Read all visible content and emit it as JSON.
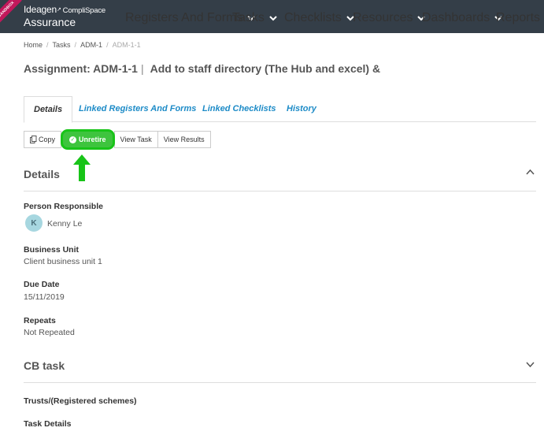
{
  "app": {
    "sandbox_ribbon": "SANDBOX",
    "brand": "Ideagen",
    "brand_sub": "CompliSpace",
    "brand_line2": "Assurance"
  },
  "nav": [
    {
      "label": "Registers And Forms"
    },
    {
      "label": "Tasks"
    },
    {
      "label": "Checklists"
    },
    {
      "label": "Resources"
    },
    {
      "label": "Dashboards"
    },
    {
      "label": "Reports"
    }
  ],
  "breadcrumb": [
    "Home",
    "Tasks",
    "ADM-1",
    "ADM-1-1"
  ],
  "page": {
    "title_prefix": "Assignment:",
    "title_id": "ADM-1-1",
    "title_bar": "|",
    "title_name": "Add to staff directory (The Hub and excel) &"
  },
  "tabs": [
    {
      "label": "Details",
      "active": true
    },
    {
      "label": "Linked Registers And Forms",
      "active": false
    },
    {
      "label": "Linked Checklists",
      "active": false
    },
    {
      "label": "History",
      "active": false
    }
  ],
  "actions": {
    "copy": "Copy",
    "unretire": "Unretire",
    "view_task": "View Task",
    "view_results": "View Results"
  },
  "details": {
    "title": "Details",
    "person_label": "Person Responsible",
    "person_initial": "K",
    "person_name": "Kenny Le",
    "bu_label": "Business Unit",
    "bu_value": "Client business unit 1",
    "due_label": "Due Date",
    "due_value": "15/11/2019",
    "repeats_label": "Repeats",
    "repeats_value": "Not Repeated"
  },
  "cb_task": {
    "title": "CB task",
    "trusts_label": "Trusts/(Registered schemes)",
    "task_details_label": "Task Details"
  },
  "colors": {
    "nav_bg": "#343e48",
    "link": "#1d8bc7",
    "highlight": "#18c418"
  }
}
